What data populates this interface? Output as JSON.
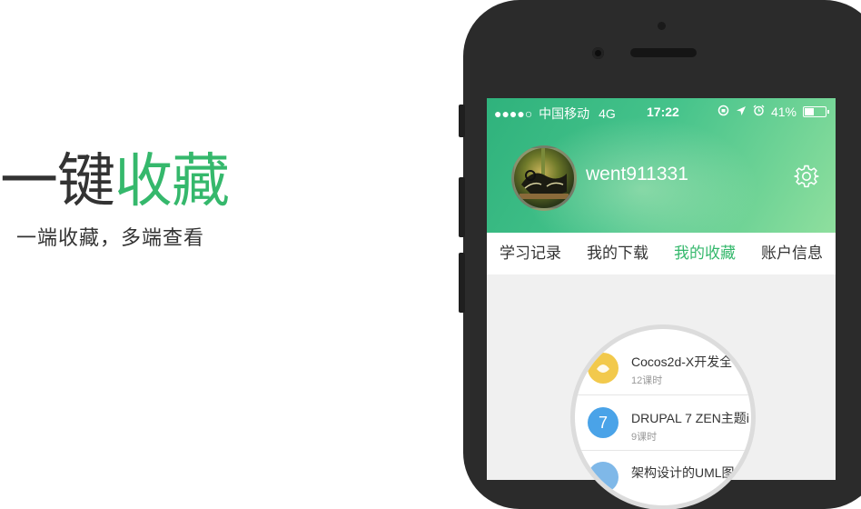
{
  "promo": {
    "headline_plain": "一键",
    "headline_accent": "收藏",
    "subline": "一端收藏，多端查看"
  },
  "status_bar": {
    "signal": "●●●●○",
    "carrier": "中国移动",
    "network": "4G",
    "time": "17:22",
    "battery_percent": "41%",
    "battery_level": 0.41
  },
  "profile": {
    "username": "went911331",
    "settings_icon": "gear-icon"
  },
  "tabs": [
    {
      "label": "学习记录",
      "active": false
    },
    {
      "label": "我的下载",
      "active": false
    },
    {
      "label": "我的收藏",
      "active": true
    },
    {
      "label": "账户信息",
      "active": false
    }
  ],
  "courses": [
    {
      "title": "Cocos2d-X开发全",
      "meta": "12课时",
      "icon_color": "#f2c94c"
    },
    {
      "title": "DRUPAL 7 ZEN主题i",
      "meta": "9课时",
      "icon_color": "#4aa3e8",
      "icon_glyph": "7"
    },
    {
      "title": "架构设计的UML图",
      "meta": "",
      "icon_color": "#7fb8e8"
    }
  ],
  "colors": {
    "accent": "#35b86c",
    "header_gradient_start": "#2fb27c",
    "header_gradient_end": "#8fdf9e",
    "phone_body": "#2b2b2b"
  }
}
